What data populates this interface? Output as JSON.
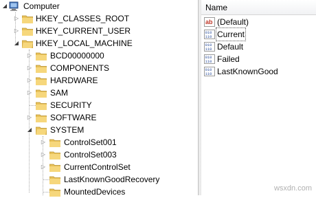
{
  "tree": {
    "root": "Computer",
    "hives": [
      "HKEY_CLASSES_ROOT",
      "HKEY_CURRENT_USER",
      "HKEY_LOCAL_MACHINE"
    ],
    "hklm_children": [
      "BCD00000000",
      "COMPONENTS",
      "HARDWARE",
      "SAM",
      "SECURITY",
      "SOFTWARE",
      "SYSTEM"
    ],
    "system_children": [
      "ControlSet001",
      "ControlSet003",
      "CurrentControlSet",
      "LastKnownGoodRecovery",
      "MountedDevices"
    ]
  },
  "list": {
    "column_name": "Name",
    "values": [
      {
        "name": "(Default)",
        "icon": "string-value-icon"
      },
      {
        "name": "Current",
        "icon": "binary-value-icon"
      },
      {
        "name": "Default",
        "icon": "binary-value-icon"
      },
      {
        "name": "Failed",
        "icon": "binary-value-icon"
      },
      {
        "name": "LastKnownGood",
        "icon": "binary-value-icon"
      }
    ]
  },
  "icons": {
    "folder": "folder-icon",
    "computer": "computer-icon",
    "expand": "triangle-right-icon",
    "collapse": "triangle-down-icon"
  },
  "colors": {
    "folder": "#e8c15a",
    "string_icon": "#c0392b",
    "binary_icon": "#2b4f9e"
  },
  "watermark": "wsxdn.com"
}
